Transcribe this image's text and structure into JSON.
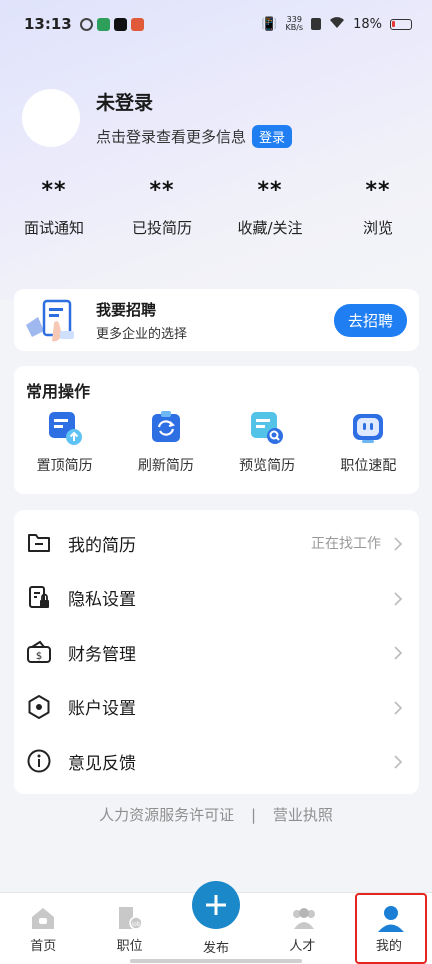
{
  "status_bar": {
    "time": "13:13",
    "net_speed_value": "339",
    "net_speed_unit": "KB/s",
    "battery": "18%"
  },
  "profile": {
    "name": "未登录",
    "subtitle": "点击登录查看更多信息",
    "login_label": "登录"
  },
  "stats": [
    {
      "value": "**",
      "label": "面试通知"
    },
    {
      "value": "**",
      "label": "已投简历"
    },
    {
      "value": "**",
      "label": "收藏/关注"
    },
    {
      "value": "**",
      "label": "浏览"
    }
  ],
  "recruit": {
    "title": "我要招聘",
    "subtitle": "更多企业的选择",
    "button": "去招聘"
  },
  "common_ops": {
    "title": "常用操作",
    "items": [
      {
        "label": "置顶简历",
        "icon": "pin-resume-icon"
      },
      {
        "label": "刷新简历",
        "icon": "refresh-resume-icon"
      },
      {
        "label": "预览简历",
        "icon": "preview-resume-icon"
      },
      {
        "label": "职位速配",
        "icon": "job-match-icon"
      }
    ]
  },
  "menu": [
    {
      "label": "我的简历",
      "extra": "正在找工作",
      "icon": "folder-icon"
    },
    {
      "label": "隐私设置",
      "extra": "",
      "icon": "privacy-lock-icon"
    },
    {
      "label": "财务管理",
      "extra": "",
      "icon": "wallet-icon"
    },
    {
      "label": "账户设置",
      "extra": "",
      "icon": "hexagon-settings-icon"
    },
    {
      "label": "意见反馈",
      "extra": "",
      "icon": "info-icon"
    }
  ],
  "footer": {
    "license": "人力资源服务许可证",
    "separator": "|",
    "business": "营业执照"
  },
  "tabbar": [
    {
      "label": "首页",
      "icon": "home-icon"
    },
    {
      "label": "职位",
      "icon": "job-icon"
    },
    {
      "label": "发布",
      "icon": "plus-icon"
    },
    {
      "label": "人才",
      "icon": "talent-icon"
    },
    {
      "label": "我的",
      "icon": "user-icon"
    }
  ],
  "colors": {
    "accent": "#1f7ef2",
    "active_tab": "#1b7fd6",
    "highlight": "#e52521"
  }
}
